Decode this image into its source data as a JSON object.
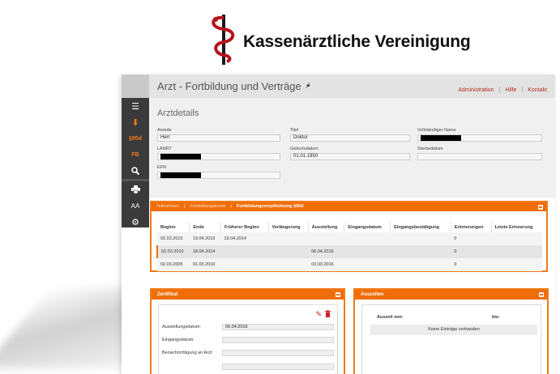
{
  "logo": {
    "text": "Kassenärztliche Vereinigung"
  },
  "header": {
    "title": "Arzt - Fortbildung und Verträge",
    "nav": [
      "Administration",
      "Hilfe",
      "Kontakt"
    ]
  },
  "sidebar": {
    "items": [
      {
        "icon": "menu-icon"
      },
      {
        "icon": "download-icon"
      },
      {
        "label": "§95d"
      },
      {
        "label": "FB"
      },
      {
        "icon": "search-icon"
      },
      {
        "icon": "print-icon"
      },
      {
        "label": "AA"
      },
      {
        "icon": "gear-icon"
      }
    ]
  },
  "details": {
    "title": "Arztdetails",
    "anrede_label": "Anrede",
    "anrede_value": "Herr",
    "titel_label": "Titel",
    "titel_value": "Doktor",
    "name_label": "Vollständiger Name",
    "lanr_label": "LANR7",
    "geburt_label": "Geburtsdatum",
    "geburt_value": "01.01.1950",
    "sterbe_label": "Sterbedatum",
    "efn_label": "EFN"
  },
  "fortbildung": {
    "tabs": [
      "Teilnahmen",
      "Fortbildungskonto",
      "Fortbildungsverpflichtung §95d"
    ],
    "columns": [
      "Beginn",
      "Ende",
      "Früherer Beginn",
      "Verlängerung",
      "Ausstellung",
      "Eingangsdatum",
      "Eingangsbestätigung",
      "Erinnerungen",
      "Letzte Erinnerung"
    ],
    "rows": [
      [
        "02.03.2015",
        "19.04.2019",
        "19.04.2014",
        "",
        "",
        "",
        "",
        "0",
        ""
      ],
      [
        "02.03.2010",
        "18.04.2014",
        "",
        "",
        "06.04.2016",
        "",
        "",
        "0",
        ""
      ],
      [
        "02.03.2005",
        "01.03.2010",
        "",
        "",
        "03.03.2016",
        "",
        "",
        "0",
        ""
      ]
    ]
  },
  "zertifikat": {
    "title": "Zertifikat",
    "ausstellung_label": "Ausstellungsdatum:",
    "ausstellung_value": "06.04.2016",
    "eingang_label": "Eingangsdatum:",
    "benachrichtigung_label": "Benachrichtigung an Arzt:"
  },
  "auszeiten": {
    "title": "Auszeiten",
    "von_label": "Auszeit von:",
    "bis_label": "bis:",
    "empty": "Keine Einträge vorhanden"
  },
  "colors": {
    "accent": "#f06d0a",
    "sidebar": "#3a3a3a",
    "link": "#b22d1f"
  }
}
